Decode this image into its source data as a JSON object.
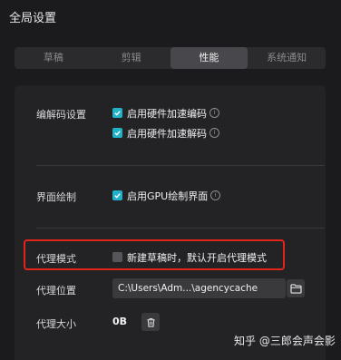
{
  "window": {
    "title": "全局设置"
  },
  "tabs": [
    {
      "label": "草稿",
      "active": false
    },
    {
      "label": "剪辑",
      "active": false
    },
    {
      "label": "性能",
      "active": true
    },
    {
      "label": "系统通知",
      "active": false
    }
  ],
  "codec": {
    "label": "编解码设置",
    "options": [
      {
        "text": "启用硬件加速编码",
        "checked": true
      },
      {
        "text": "启用硬件加速解码",
        "checked": true
      }
    ]
  },
  "render": {
    "label": "界面绘制",
    "option": {
      "text": "启用GPU绘制界面",
      "checked": true
    }
  },
  "proxy_mode": {
    "label": "代理模式",
    "option": {
      "text": "新建草稿时，默认开启代理模式",
      "checked": false
    }
  },
  "proxy_location": {
    "label": "代理位置",
    "path": "C:\\Users\\Adm...\\agencycache",
    "folder_icon": "folder-icon"
  },
  "proxy_size": {
    "label": "代理大小",
    "value": "0B",
    "delete_icon": "trash-icon"
  },
  "watermark": "知乎 @三郎会声会影",
  "colors": {
    "accent": "#22b2c8",
    "highlight": "#e1251b",
    "background": "#1b1b1d"
  }
}
